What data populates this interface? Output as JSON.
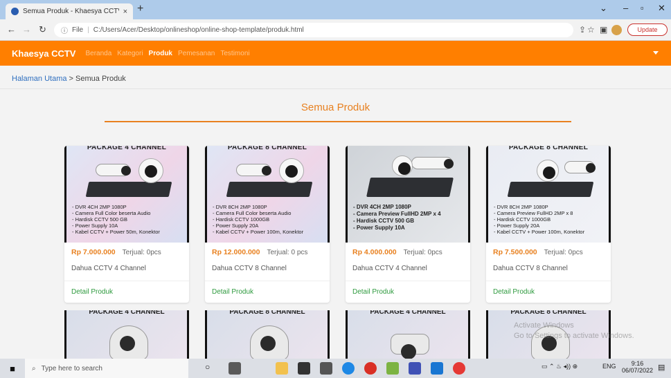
{
  "browser": {
    "tab_title": "Semua Produk - Khaesya CCTV",
    "tab_close": "×",
    "new_tab": "+",
    "url": "C:/Users/Acer/Desktop/onlineshop/online-shop-template/produk.html",
    "file_label": "File",
    "update_label": "Update"
  },
  "navbar": {
    "brand": "Khaesya CCTV",
    "links": [
      "Beranda",
      "Kategori",
      "Produk",
      "Pemesanan",
      "Testimoni"
    ],
    "active": "Produk"
  },
  "breadcrumb": {
    "home": "Halaman Utama",
    "separator": ">",
    "current": "Semua Produk"
  },
  "section_title": "Semua Produk",
  "products": [
    {
      "heading": "PACKAGE 4 CHANNEL",
      "specs": [
        "- DVR 4CH 2MP 1080P",
        "- Camera Full Color beserta Audio",
        "- Hardisk CCTV 500 GB",
        "- Power Supply 10A",
        "- Kabel CCTV + Power 50m, Konektor"
      ],
      "price": "Rp 7.000.000",
      "sold": "Terjual: 0pcs",
      "name": "Dahua CCTV 4 Channel",
      "link": "Detail Produk"
    },
    {
      "heading": "PACKAGE 8 CHANNEL",
      "specs": [
        "- DVR 8CH 2MP 1080P",
        "- Camera Full Color beserta Audio",
        "- Hardisk CCTV 1000GB",
        "- Power Supply 20A",
        "- Kabel CCTV + Power 100m, Konektor"
      ],
      "price": "Rp 12.000.000",
      "sold": "Terjual: 0 pcs",
      "name": "Dahua CCTV 8 Channel",
      "link": "Detail Produk"
    },
    {
      "heading": "",
      "specs": [
        "- DVR 4CH 2MP 1080P",
        "- Camera Preview FullHD 2MP x 4",
        "- Hardisk CCTV 500 GB",
        "- Power Supply 10A"
      ],
      "price": "Rp 4.000.000",
      "sold": "Terjual: 0pcs",
      "name": "Dahua CCTV 4 Channel",
      "link": "Detail Produk"
    },
    {
      "heading": "PACKAGE 8 CHANNEL",
      "specs": [
        "- DVR 8CH 2MP 1080P",
        "- Camera Preview FullHD 2MP x 8",
        "- Hardisk CCTV 1000GB",
        "- Power Supply 20A",
        "- Kabel CCTV + Power 100m, Konektor"
      ],
      "price": "Rp 7.500.000",
      "sold": "Terjual: 0pcs",
      "name": "Dahua CCTV 8 Channel",
      "link": "Detail Produk"
    }
  ],
  "second_row": [
    "PACKAGE 4 CHANNEL",
    "PACKAGE 8 CHANNEL",
    "PACKAGE 4 CHANNEL",
    "PACKAGE 8 CHANNEL"
  ],
  "watermark": [
    "Activate Windows",
    "Go to Settings to activate Windows."
  ],
  "taskbar": {
    "search_placeholder": "Type here to search",
    "lang": "ENG",
    "time": "9:16",
    "date": "06/07/2022"
  },
  "colors": {
    "accent": "#ff7f00",
    "title": "#e8801f",
    "link_green": "#2e9a3e"
  }
}
